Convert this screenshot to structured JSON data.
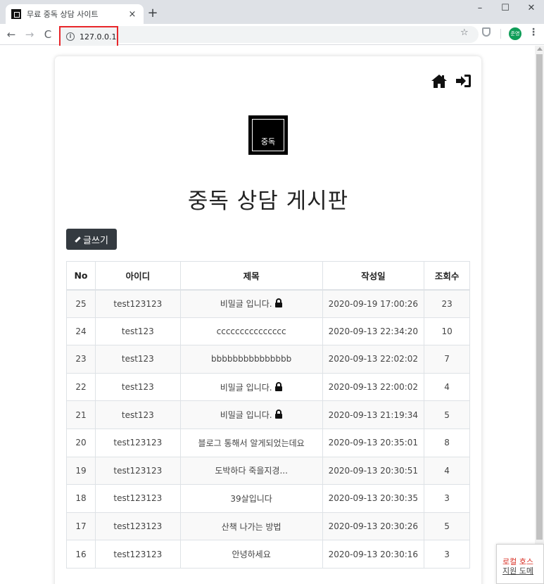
{
  "browser": {
    "tab_title": "무료 중독 상담 사이트",
    "tab_close": "×",
    "new_tab": "+",
    "url": "127.0.0.1",
    "window_min": "–",
    "window_max": "☐",
    "window_close": "✕",
    "profile_label": "준영"
  },
  "page": {
    "logo_text": "중독",
    "board_title": "중독 상담 게시판",
    "write_button_label": "글쓰기"
  },
  "table": {
    "headers": [
      "No",
      "아이디",
      "제목",
      "작성일",
      "조회수"
    ],
    "rows": [
      {
        "no": "25",
        "id": "test123123",
        "title": "비밀글 입니다.",
        "locked": true,
        "date": "2020-09-19 17:00:26",
        "views": "23"
      },
      {
        "no": "24",
        "id": "test123",
        "title": "ccccccccccccccc",
        "locked": false,
        "date": "2020-09-13 22:34:20",
        "views": "10"
      },
      {
        "no": "23",
        "id": "test123",
        "title": "bbbbbbbbbbbbbbb",
        "locked": false,
        "date": "2020-09-13 22:02:02",
        "views": "7"
      },
      {
        "no": "22",
        "id": "test123",
        "title": "비밀글 입니다.",
        "locked": true,
        "date": "2020-09-13 22:00:02",
        "views": "4"
      },
      {
        "no": "21",
        "id": "test123",
        "title": "비밀글 입니다.",
        "locked": true,
        "date": "2020-09-13 21:19:34",
        "views": "5"
      },
      {
        "no": "20",
        "id": "test123123",
        "title": "블로그 통해서 알게되었는데요",
        "locked": false,
        "date": "2020-09-13 20:35:01",
        "views": "8"
      },
      {
        "no": "19",
        "id": "test123123",
        "title": "도박하다 죽을지경...",
        "locked": false,
        "date": "2020-09-13 20:30:51",
        "views": "4"
      },
      {
        "no": "18",
        "id": "test123123",
        "title": "39살입니다",
        "locked": false,
        "date": "2020-09-13 20:30:35",
        "views": "3"
      },
      {
        "no": "17",
        "id": "test123123",
        "title": "산책 나가는 방법",
        "locked": false,
        "date": "2020-09-13 20:30:26",
        "views": "5"
      },
      {
        "no": "16",
        "id": "test123123",
        "title": "안녕하세요",
        "locked": false,
        "date": "2020-09-13 20:30:16",
        "views": "3"
      }
    ]
  },
  "toast": {
    "line1": "로컬 호스",
    "line2": "지원 도메"
  },
  "colors": {
    "write_button": "#343a40",
    "url_highlight": "#e8262a",
    "profile": "#0f9d58"
  }
}
